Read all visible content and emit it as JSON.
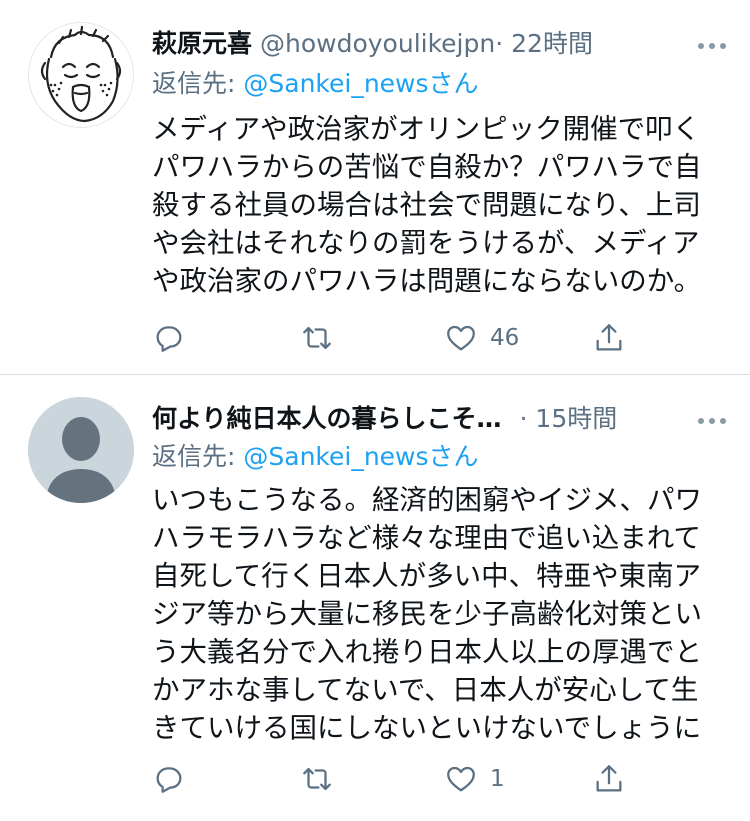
{
  "tweets": [
    {
      "name": "萩原元喜",
      "handle": "@howdoyoulikejpn",
      "time": "· 22時間",
      "reply_prefix": "返信先: ",
      "reply_mention": "@Sankei_newsさん",
      "text_lines": [
        "メディアや政治家がオリンピック開催で叩く",
        "パワハラからの苦悩で自殺か？パワハラで自",
        "殺する社員の場合は社会で問題になり、上司",
        "や会社はそれなりの罰をうけるが、メディア",
        "や政治家のパワハラは問題にならないのか。"
      ],
      "like_count": "46",
      "avatar_icon": "cartoon-face-avatar"
    },
    {
      "name": "何より純日本人の暮らしこそ…",
      "handle": "",
      "time": "· 15時間",
      "reply_prefix": "返信先: ",
      "reply_mention": "@Sankei_newsさん",
      "text_lines": [
        "いつもこうなる。経済的困窮やイジメ、パワ",
        "ハラモラハラなど様々な理由で追い込まれて",
        "自死して行く日本人が多い中、特亜や東南ア",
        "ジア等から大量に移民を少子高齢化対策とい",
        "う大義名分で入れ捲り日本人以上の厚遇でと",
        "かアホな事してないで、日本人が安心して生",
        "きていける国にしないといけないでしょうに"
      ],
      "like_count": "1",
      "avatar_icon": "default-user-avatar"
    }
  ],
  "colors": {
    "secondary_text": "#5b7083",
    "mention": "#1da1f2",
    "icon": "#5b7083",
    "divider": "#d8dde1",
    "default_avatar_bg": "#cbd5dc",
    "default_avatar_fg": "#65737e"
  },
  "icons": [
    "reply-icon",
    "retweet-icon",
    "like-icon",
    "share-icon",
    "more-icon"
  ]
}
